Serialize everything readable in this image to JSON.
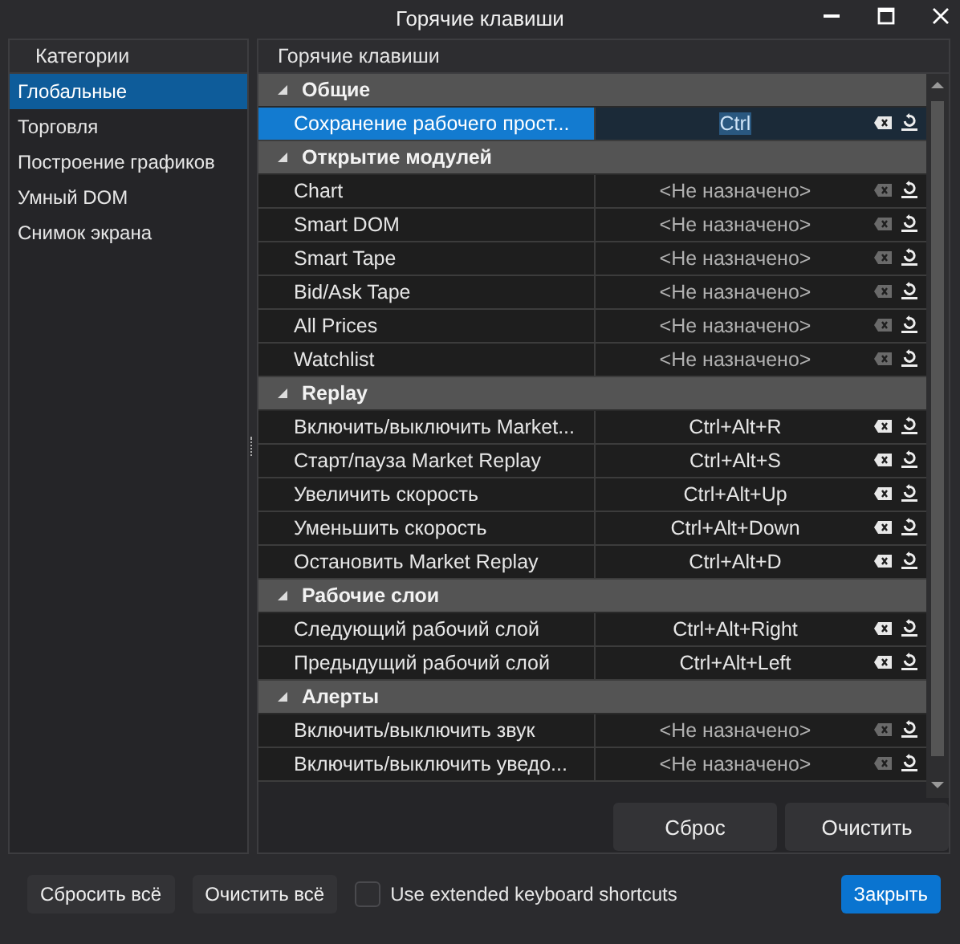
{
  "window": {
    "title": "Горячие клавиши"
  },
  "sidebar": {
    "header": "Категории",
    "items": [
      {
        "label": "Глобальные",
        "selected": true
      },
      {
        "label": "Торговля",
        "selected": false
      },
      {
        "label": "Построение графиков",
        "selected": false
      },
      {
        "label": "Умный DOM",
        "selected": false
      },
      {
        "label": "Снимок экрана",
        "selected": false
      }
    ]
  },
  "hotkeys": {
    "header": "Горячие клавиши",
    "groups": [
      {
        "title": "Общие",
        "expanded": true,
        "items": [
          {
            "name": "Сохранение рабочего прост...",
            "key": "Ctrl",
            "selected": true,
            "editing": true,
            "clear_enabled": true
          }
        ]
      },
      {
        "title": "Открытие модулей",
        "expanded": true,
        "items": [
          {
            "name": "Chart",
            "key": "<Не назначено>",
            "selected": false,
            "editing": false,
            "clear_enabled": false
          },
          {
            "name": "Smart DOM",
            "key": "<Не назначено>",
            "selected": false,
            "editing": false,
            "clear_enabled": false
          },
          {
            "name": "Smart Tape",
            "key": "<Не назначено>",
            "selected": false,
            "editing": false,
            "clear_enabled": false
          },
          {
            "name": "Bid/Ask Tape",
            "key": "<Не назначено>",
            "selected": false,
            "editing": false,
            "clear_enabled": false
          },
          {
            "name": "All Prices",
            "key": "<Не назначено>",
            "selected": false,
            "editing": false,
            "clear_enabled": false
          },
          {
            "name": "Watchlist",
            "key": "<Не назначено>",
            "selected": false,
            "editing": false,
            "clear_enabled": false
          }
        ]
      },
      {
        "title": "Replay",
        "expanded": true,
        "items": [
          {
            "name": "Включить/выключить Market...",
            "key": "Ctrl+Alt+R",
            "selected": false,
            "editing": false,
            "clear_enabled": true
          },
          {
            "name": "Старт/пауза Market Replay",
            "key": "Ctrl+Alt+S",
            "selected": false,
            "editing": false,
            "clear_enabled": true
          },
          {
            "name": "Увеличить скорость",
            "key": "Ctrl+Alt+Up",
            "selected": false,
            "editing": false,
            "clear_enabled": true
          },
          {
            "name": "Уменьшить скорость",
            "key": "Ctrl+Alt+Down",
            "selected": false,
            "editing": false,
            "clear_enabled": true
          },
          {
            "name": "Остановить Market Replay",
            "key": "Ctrl+Alt+D",
            "selected": false,
            "editing": false,
            "clear_enabled": true
          }
        ]
      },
      {
        "title": "Рабочие слои",
        "expanded": true,
        "items": [
          {
            "name": "Следующий рабочий слой",
            "key": "Ctrl+Alt+Right",
            "selected": false,
            "editing": false,
            "clear_enabled": true
          },
          {
            "name": "Предыдущий рабочий слой",
            "key": "Ctrl+Alt+Left",
            "selected": false,
            "editing": false,
            "clear_enabled": true
          }
        ]
      },
      {
        "title": "Алерты",
        "expanded": true,
        "items": [
          {
            "name": "Включить/выключить звук",
            "key": "<Не назначено>",
            "selected": false,
            "editing": false,
            "clear_enabled": false
          },
          {
            "name": "Включить/выключить уведо...",
            "key": "<Не назначено>",
            "selected": false,
            "editing": false,
            "clear_enabled": false
          }
        ]
      }
    ],
    "buttons": [
      "Сброс",
      "Очистить"
    ]
  },
  "footer": {
    "buttons": [
      "Сбросить всё",
      "Очистить всё"
    ],
    "checkbox": {
      "label": "Use extended keyboard shortcuts",
      "checked": false
    },
    "close_button": "Закрыть"
  }
}
